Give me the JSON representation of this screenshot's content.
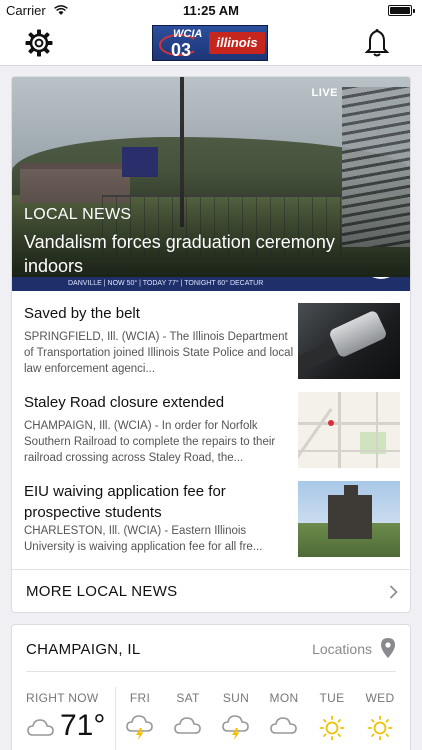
{
  "status_bar": {
    "carrier": "Carrier",
    "time": "11:25 AM"
  },
  "nav": {
    "logo_wcia": "WCIA",
    "logo_number": "03",
    "logo_state": "illinois"
  },
  "hero": {
    "live_badge": "LIVE",
    "category": "LOCAL NEWS",
    "headline": "Vandalism forces graduation ceremony indoors",
    "ticker": "DANVILLE  |  NOW  50°  |  TODAY  77°  |  TONIGHT  60°   DECATUR",
    "ticker_logo": "03"
  },
  "stories": [
    {
      "title": "Saved by the belt",
      "snippet": "SPRINGFIELD, Ill. (WCIA) - The Illinois Department of Transportation joined Illinois State Police and local law enforcement agenci..."
    },
    {
      "title": "Staley Road closure extended",
      "snippet": "CHAMPAIGN, Ill. (WCIA) - In order for Norfolk Southern Railroad to complete the repairs to their railroad crossing across Staley Road, the..."
    },
    {
      "title": "EIU waiving application fee for prospective students",
      "snippet": "CHARLESTON, Ill. (WCIA) - Eastern Illinois University is waiving application fee for all fre..."
    }
  ],
  "more_news_label": "MORE LOCAL NEWS",
  "weather": {
    "city": "CHAMPAIGN, IL",
    "locations_label": "Locations",
    "now_label": "RIGHT NOW",
    "now_temp": "71°",
    "days": [
      {
        "label": "FRI",
        "icon": "thunderstorm-icon"
      },
      {
        "label": "SAT",
        "icon": "cloudy-icon"
      },
      {
        "label": "SUN",
        "icon": "thunderstorm-icon"
      },
      {
        "label": "MON",
        "icon": "cloudy-icon"
      },
      {
        "label": "TUE",
        "icon": "sunny-icon"
      },
      {
        "label": "WED",
        "icon": "sunny-icon"
      }
    ]
  },
  "colors": {
    "accent_sun": "#f2c200",
    "storm_bolt": "#f2c200",
    "logo_blue": "#2d4f9d",
    "logo_red": "#c7261e"
  }
}
